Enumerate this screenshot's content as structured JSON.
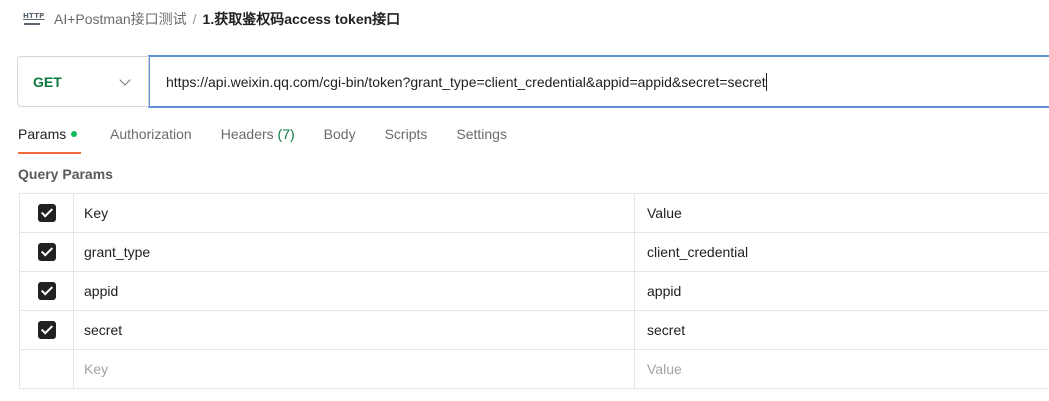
{
  "breadcrumb": {
    "icon": "http-icon",
    "parent": "AI+Postman接口测试",
    "separator": "/",
    "current": "1.获取鉴权码access token接口"
  },
  "request": {
    "method": "GET",
    "url": "https://api.weixin.qq.com/cgi-bin/token?grant_type=client_credential&appid=appid&secret=secret"
  },
  "tabs": {
    "params": "Params",
    "authorization": "Authorization",
    "headers": "Headers",
    "headers_count": "(7)",
    "body": "Body",
    "scripts": "Scripts",
    "settings": "Settings"
  },
  "query_params": {
    "title": "Query Params",
    "header_key": "Key",
    "header_value": "Value",
    "rows": [
      {
        "key": "grant_type",
        "value": "client_credential",
        "checked": true
      },
      {
        "key": "appid",
        "value": "appid",
        "checked": true
      },
      {
        "key": "secret",
        "value": "secret",
        "checked": true
      }
    ],
    "placeholder_key": "Key",
    "placeholder_value": "Value"
  },
  "colors": {
    "accent": "#f26b3a",
    "method_get": "#0b7a3f",
    "url_focus_border": "#5f90d6",
    "status_dot": "#0cbb52"
  }
}
